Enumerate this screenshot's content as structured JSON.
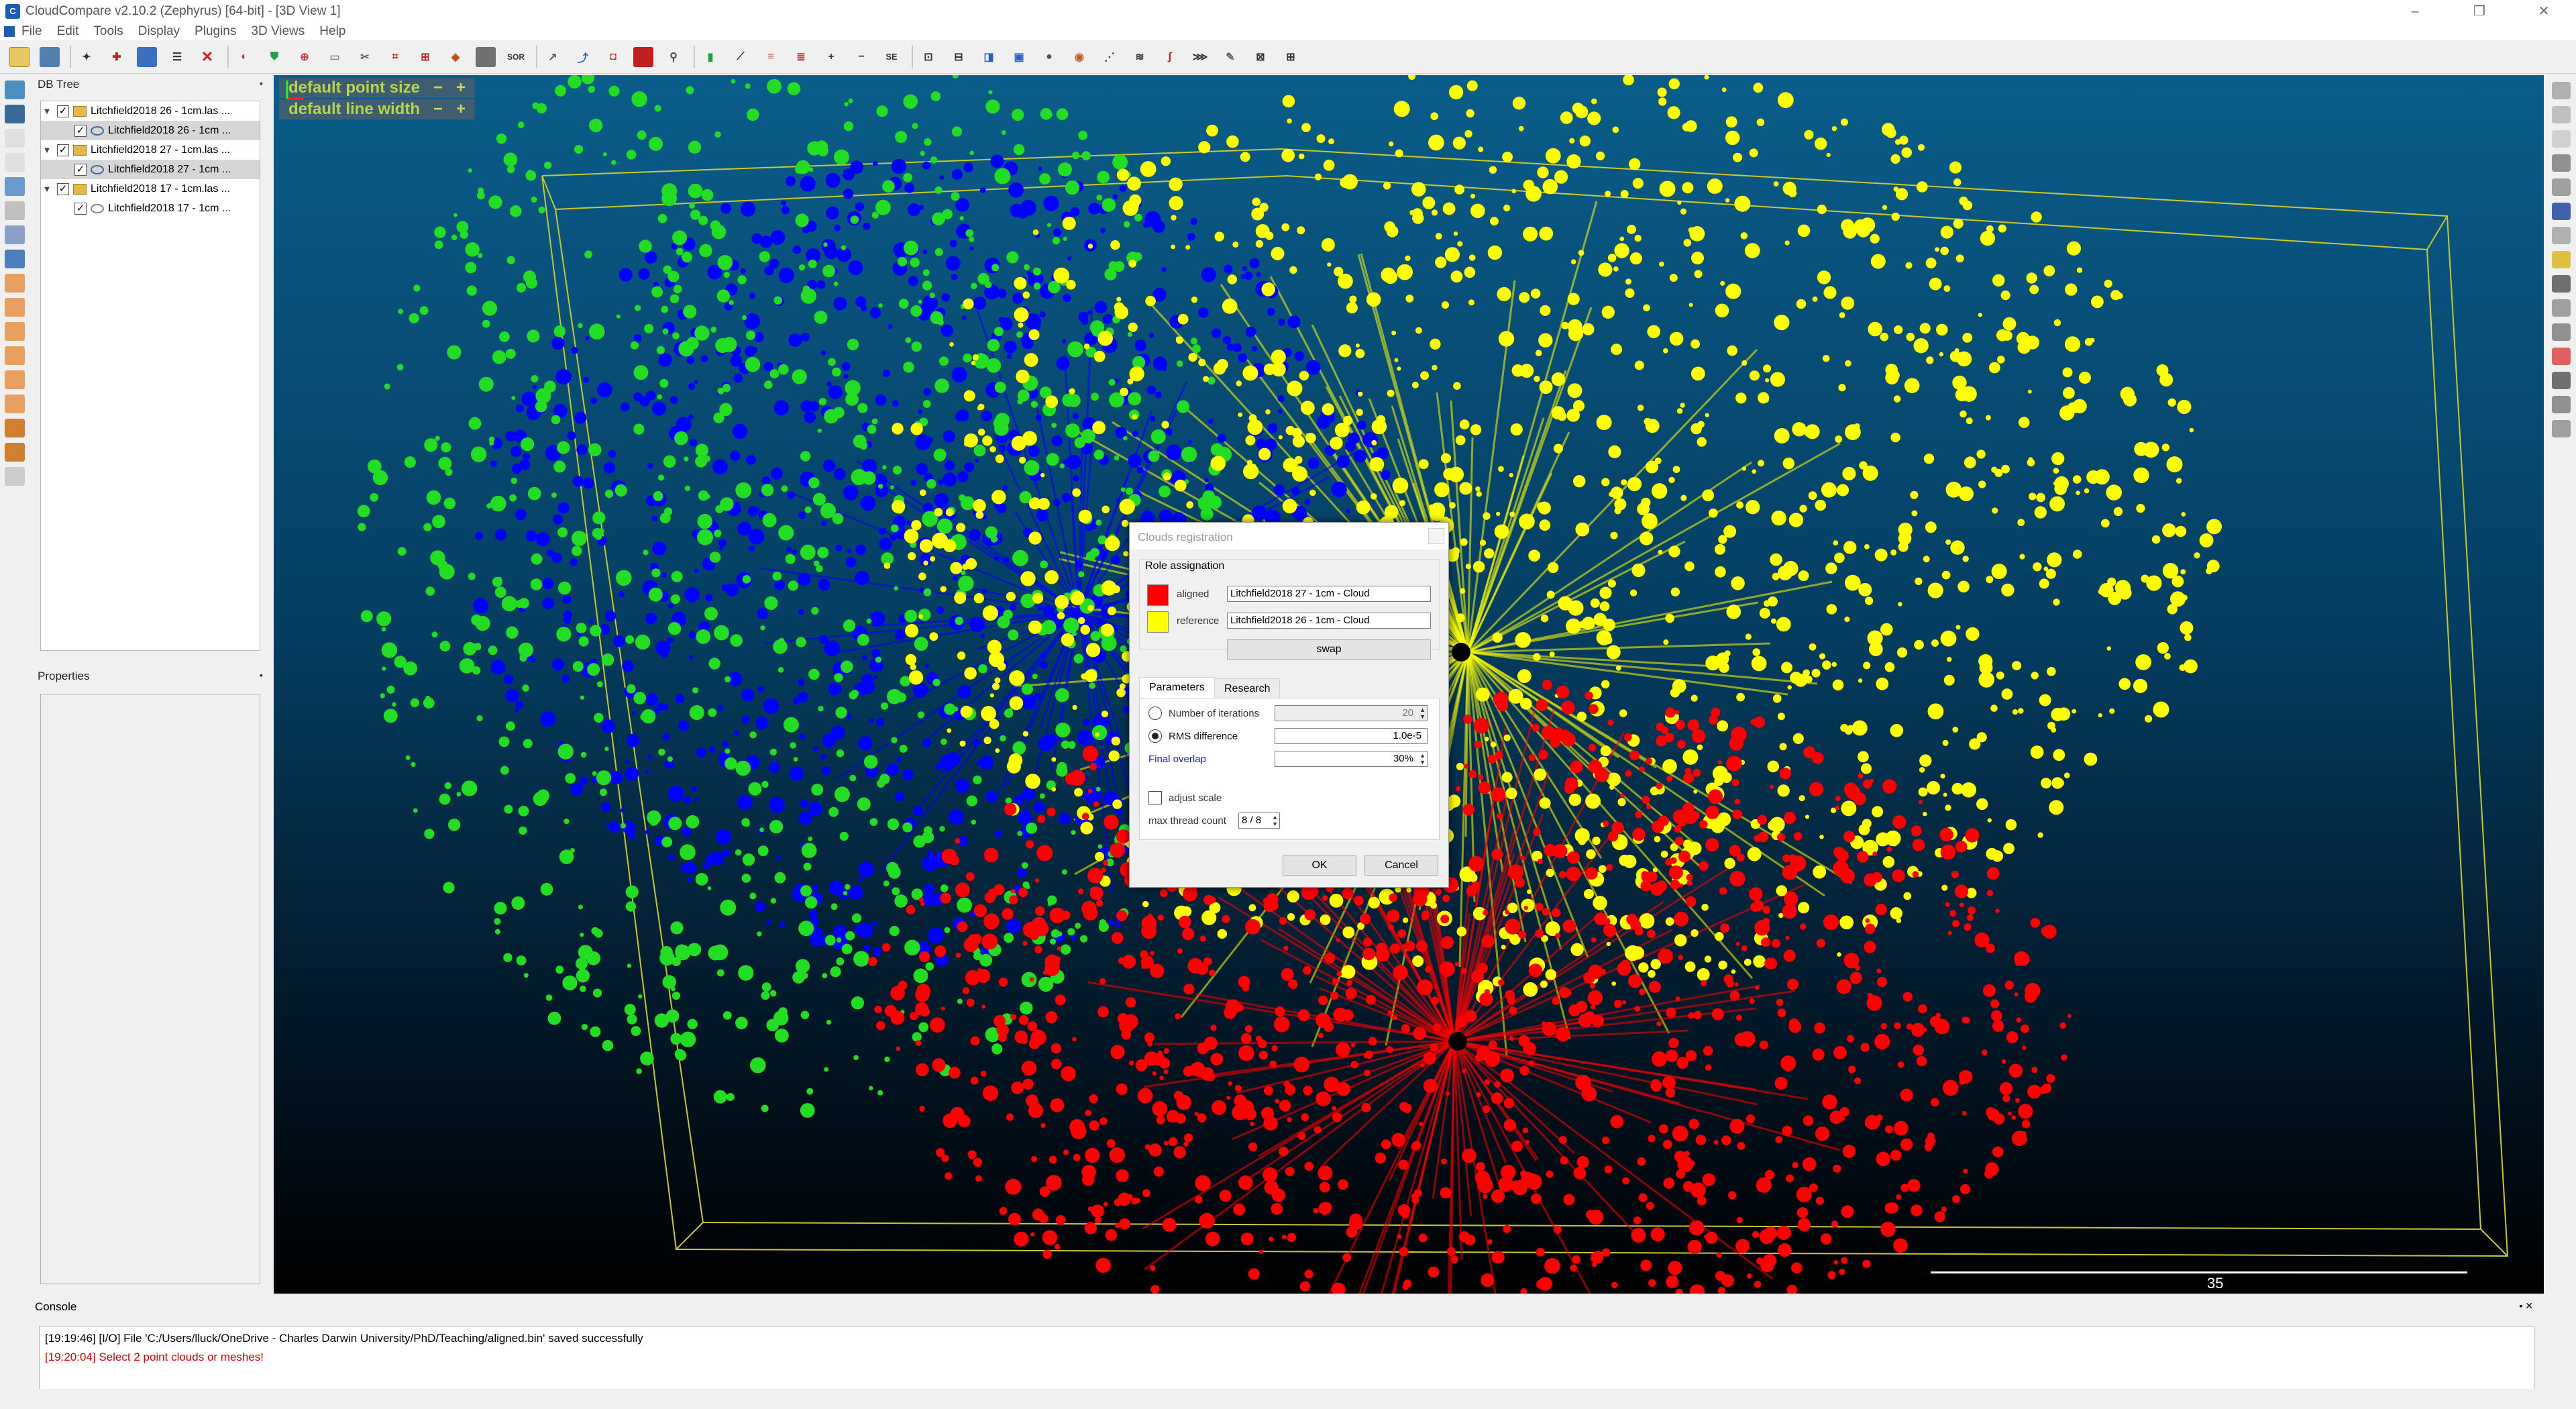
{
  "window": {
    "title": "CloudCompare v2.10.2 (Zephyrus) [64-bit] - [3D View 1]"
  },
  "menu": [
    "File",
    "Edit",
    "Tools",
    "Display",
    "Plugins",
    "3D Views",
    "Help"
  ],
  "toolbar": {
    "sor_label": "SOR",
    "se_label": "SE",
    "icons": [
      "open-icon",
      "save-icon",
      "settings-icon",
      "pick-icon",
      "clone-icon",
      "merge-icon",
      "delete-icon"
    ]
  },
  "db_tree": {
    "title": "DB Tree",
    "items": [
      {
        "label": "Litchfield2018 26 - 1cm.las ...",
        "level": 0,
        "kind": "folder"
      },
      {
        "label": "Litchfield2018 26 - 1cm ...",
        "level": 1,
        "kind": "cloud",
        "selected": true
      },
      {
        "label": "Litchfield2018 27 - 1cm.las ...",
        "level": 0,
        "kind": "folder"
      },
      {
        "label": "Litchfield2018 27 - 1cm ...",
        "level": 1,
        "kind": "cloud",
        "selected": true
      },
      {
        "label": "Litchfield2018 17 - 1cm.las ...",
        "level": 0,
        "kind": "folder"
      },
      {
        "label": "Litchfield2018 17 - 1cm ...",
        "level": 1,
        "kind": "cloud",
        "selected": false
      }
    ]
  },
  "properties": {
    "title": "Properties"
  },
  "view": {
    "hud_point_size": "default point size",
    "hud_line_width": "default line width",
    "hud_minus": "−",
    "hud_plus": "+",
    "scale_label": "35",
    "colors": {
      "aligned": "#ff0000",
      "reference": "#ffff00",
      "other": "#0000ff",
      "green": "#22dd22"
    }
  },
  "dialog": {
    "title": "Clouds registration",
    "role_group": "Role assignation",
    "aligned_label": "aligned",
    "aligned_value": "Litchfield2018 27 - 1cm - Cloud",
    "reference_label": "reference",
    "reference_value": "Litchfield2018 26 - 1cm - Cloud",
    "swap_label": "swap",
    "tabs": [
      "Parameters",
      "Research"
    ],
    "iterations_label": "Number of iterations",
    "iterations_value": "20",
    "rms_label": "RMS difference",
    "rms_value": "1.0e-5",
    "overlap_label": "Final overlap",
    "overlap_value": "30%",
    "adjust_scale_label": "adjust scale",
    "thread_label": "max thread count",
    "thread_value": "8 / 8",
    "ok_label": "OK",
    "cancel_label": "Cancel",
    "aligned_color": "#ff0000",
    "reference_color": "#ffff00"
  },
  "console": {
    "title": "Console",
    "lines": [
      {
        "text": "[19:19:46] [I/O] File 'C:/Users/lluck/OneDrive - Charles Darwin University/PhD/Teaching/aligned.bin' saved successfully",
        "color": "#000000"
      },
      {
        "text": "[19:20:04] Select 2 point clouds or meshes!",
        "color": "#e00000"
      }
    ]
  }
}
